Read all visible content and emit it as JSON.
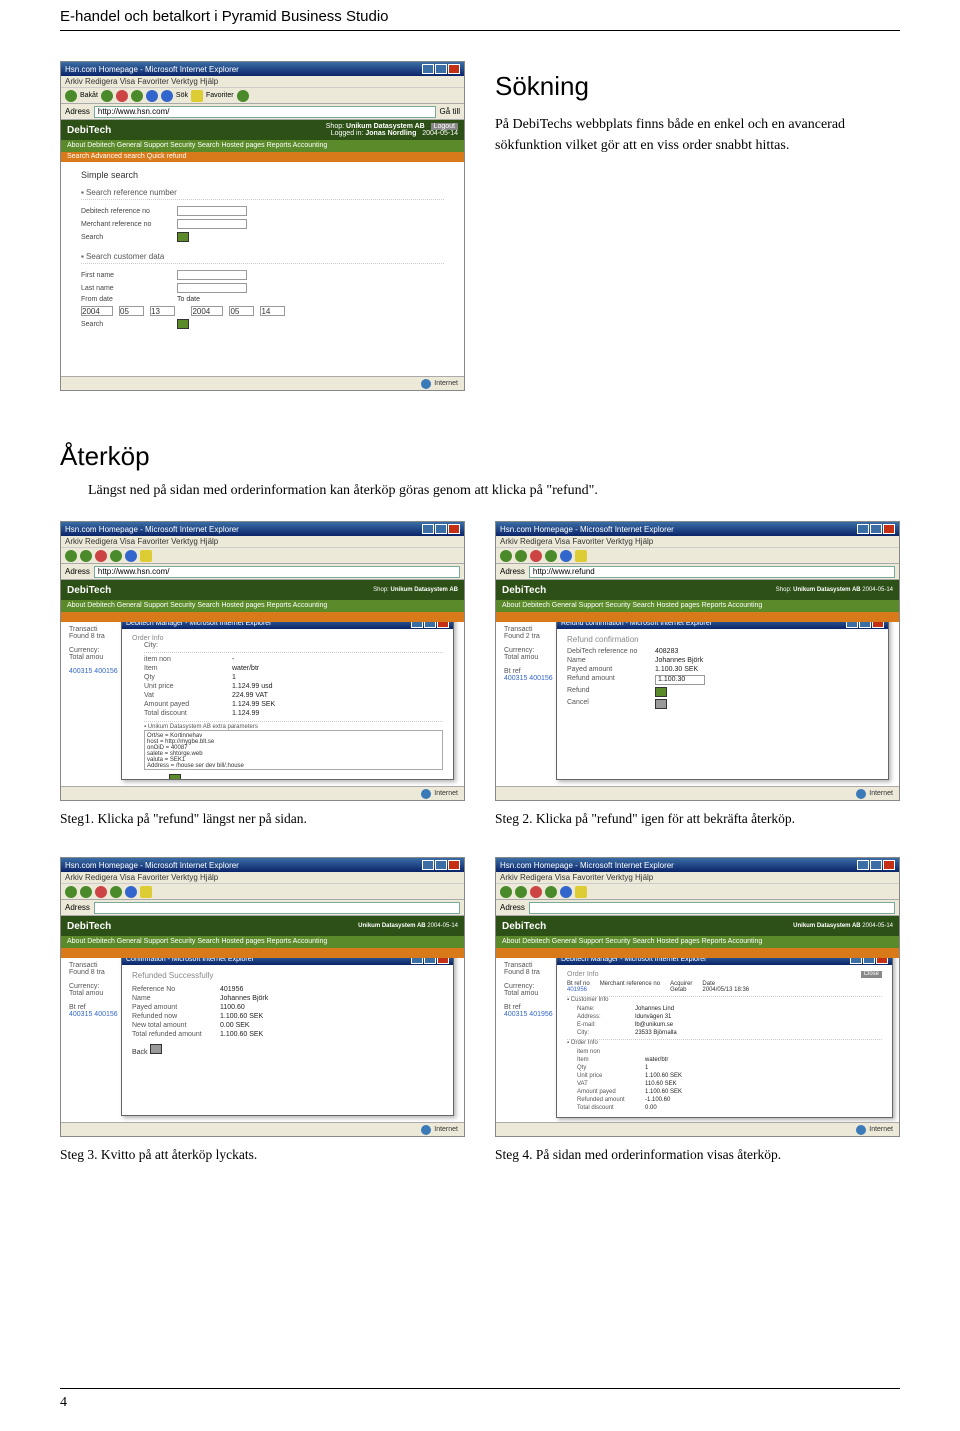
{
  "header": {
    "doc_title": "E-handel och betalkort i Pyramid Business Studio"
  },
  "sokning": {
    "title": "Sökning",
    "text": "På DebiTechs webbplats finns både en enkel och en avancerad sökfunktion vilket gör att en viss order snabbt hittas."
  },
  "aterkop": {
    "title": "Återköp",
    "intro": "Längst ned på sidan med orderinformation kan återköp göras genom att klicka på \"refund\".",
    "caption1": "Steg1. Klicka på \"refund\" längst ner på sidan.",
    "caption2": "Steg 2. Klicka på \"refund\" igen för att bekräfta återköp.",
    "caption3": "Steg 3. Kvitto på att återköp lyckats.",
    "caption4": "Steg 4. På sidan med orderinformation visas återköp."
  },
  "page_number": "4",
  "browser": {
    "title": "Hsn.com Homepage - Microsoft Internet Explorer",
    "menu": "Arkiv  Redigera  Visa  Favoriter  Verktyg  Hjälp",
    "addr_label": "Adress",
    "addr_value": "http://www.hsn.com/",
    "go": "Gå till",
    "back": "Bakåt",
    "search_label": "Sök",
    "fav_label": "Favoriter",
    "status": "Internet"
  },
  "debitech": {
    "logo": "DebiTech",
    "shop_label": "Shop:",
    "shop_value": "Unikum Datasystem AB",
    "logged_label": "Logged in:",
    "logged_value": "Jonas Nordling",
    "date": "2004-05-14",
    "logout": "Logout",
    "nav": "About Debitech   General   Support   Security   Search   Hosted pages   Reports   Accounting",
    "subnav": "Search   Advanced search   Quick refund"
  },
  "simple_search": {
    "title": "Simple search",
    "ref_hdr": "▪ Search reference number",
    "debitech_ref": "Debitech reference no",
    "merchant_ref": "Merchant reference no",
    "search_btn": "Search",
    "cust_hdr": "▪ Search customer data",
    "first_name": "First name",
    "last_name": "Last name",
    "from_date": "From date",
    "to_date": "To date",
    "date_y1": "2004",
    "date_m1": "05",
    "date_d1": "13",
    "date_y2": "2004",
    "date_m2": "05",
    "date_d2": "14"
  },
  "step1": {
    "popup_title": "Debitech Manager - Microsoft Internet Explorer",
    "order_info": "Order Info",
    "city": "City:",
    "transact": "Transacti",
    "found": "Found 8 tra",
    "currency": "Currency:",
    "total": "Total amou",
    "item_non": "item non",
    "qty": "Qty",
    "unit_price": "Unit price",
    "vat": "Vat",
    "amount_payed": "Amount payed",
    "total_discount": "Total discount",
    "ref_nos": "400315\n400156",
    "extra_params": "▪ Unikum Datasystem AB extra parameters",
    "refund": "Refund",
    "vals": {
      "item": "water/btr",
      "qty": "1",
      "unit": "1.124.99 usd",
      "vat": "224.99 VAT",
      "payed": "1.124.99 SEK",
      "disc": "1.124.99"
    },
    "params_text": "Ort/se = Kortinnehav\nhost = http://mygbe.blt.se\nonOiD = 40087\nsalete = shtorge.web\nvaluta = SEK1\nAddress = /house ser dev bill/.house\nkorttext = kortbetalningen har avslutyt."
  },
  "step2": {
    "popup_title": "Refund confirmation - Microsoft Internet Explorer",
    "hdr": "Refund confirmation",
    "debitech_ref": "DebiTech reference no",
    "name": "Name",
    "payed": "Payed amount",
    "refund_amt": "Refund amount",
    "refund_btn": "Refund",
    "cancel_btn": "Cancel",
    "vals": {
      "ref": "408283",
      "name": "Johannes Björk",
      "payed": "1.100.30 SEK",
      "refund": "1.100.30"
    },
    "left_refs": "400315\n400156"
  },
  "step3": {
    "popup_title": "Confirmation - Microsoft Internet Explorer",
    "hdr": "Refunded Successfully",
    "ref_no": "Reference No",
    "name": "Name",
    "payed": "Payed amount",
    "refunded_now": "Refunded now",
    "new_total": "New total amount",
    "total_refunded": "Total refunded amount",
    "vals": {
      "ref": "401956",
      "name": "Johannes Björk",
      "payed": "1100.60",
      "refunded": "1.100.60 SEK",
      "newtotal": "0.00 SEK",
      "totalref": "1.100.60 SEK"
    },
    "back": "Back"
  },
  "step4": {
    "popup_title": "Debitech Manager - Microsoft Internet Explorer",
    "hdr": "Order Info",
    "close": "Close",
    "bt_ref": "Bt ref no",
    "merch_ref": "Merchant reference no",
    "acquirer": "Acquirer",
    "date": "Date",
    "vals_top": {
      "bt": "401956",
      "merch": "",
      "acq": "Getab",
      "date": "2004/05/13 18:36"
    },
    "customer_hdr": "▪ Customer Info",
    "cust": {
      "name_k": "Name:",
      "name_v": "Johannes Lind",
      "addr_k": "Address:",
      "addr_v": "Idunvägen 31",
      "email_k": "E-mail:",
      "email_v": "lb@unikum.se",
      "city_k": "City:",
      "city_v": "23533 Björnalla"
    },
    "order_hdr": "▪ Order Info",
    "order": {
      "item_non": "item non",
      "item": "Item",
      "item_v": "water/btr",
      "qty": "Qty",
      "qty_v": "1",
      "unit": "Unit price",
      "unit_v": "1.100.60 SEK",
      "vat": "VAT",
      "vat_v": "110.60 SEK",
      "payed": "Amount payed",
      "payed_v": "1.100.60 SEK",
      "refunded": "Refunded amount",
      "refunded_v": "-1.100.60",
      "discount": "Total discount",
      "discount_v": "0.00"
    },
    "left_refs": "400315\n401956"
  }
}
